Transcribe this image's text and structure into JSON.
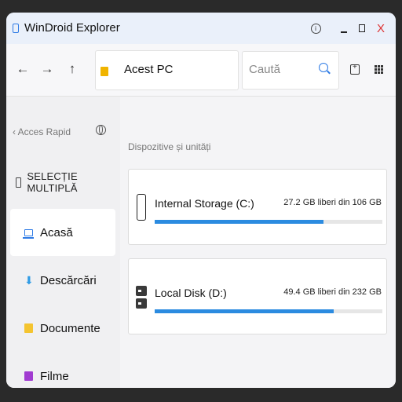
{
  "window": {
    "title": "WinDroid Explorer",
    "controls": {
      "info": "i",
      "close": "X"
    }
  },
  "toolbar": {
    "address": "Acest PC",
    "search_placeholder": "Caută"
  },
  "sidebar": {
    "quick_access": "Acces Rapid",
    "multi_select": "SELECȚIE MULTIPLĂ",
    "items": [
      {
        "label": "Acasă",
        "icon": "home-icon",
        "active": true
      },
      {
        "label": "Descărcări",
        "icon": "download-icon",
        "active": false
      },
      {
        "label": "Documente",
        "icon": "document-icon",
        "active": false
      },
      {
        "label": "Filme",
        "icon": "film-icon",
        "active": false
      }
    ]
  },
  "main": {
    "section_title": "Dispozitive și unități",
    "drives": [
      {
        "name": "Internal Storage (C:)",
        "free_text": "27.2 GB liberi din 106 GB",
        "used_fraction": 0.743,
        "icon": "phone-icon"
      },
      {
        "name": "Local Disk (D:)",
        "free_text": "49.4 GB liberi din 232 GB",
        "used_fraction": 0.787,
        "icon": "disk-icon"
      }
    ]
  },
  "colors": {
    "accent": "#2f7be5",
    "usage_bar": "#2b8be0",
    "close": "#dd3333",
    "folder": "#f0b400"
  }
}
